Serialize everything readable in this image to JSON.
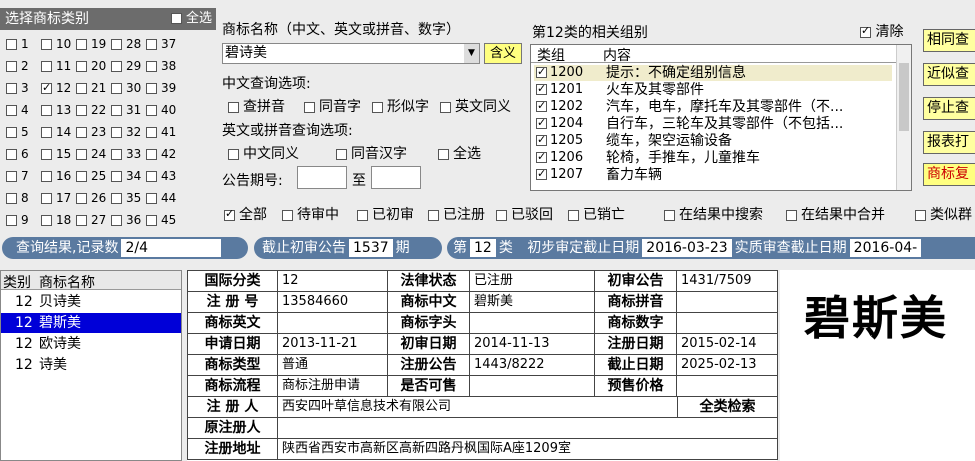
{
  "class_panel": {
    "title": "选择商标类别",
    "select_all": "全选",
    "classes": [
      [
        "1",
        "10",
        "19",
        "28",
        "37"
      ],
      [
        "2",
        "11",
        "20",
        "29",
        "38"
      ],
      [
        "3",
        "12",
        "21",
        "30",
        "39"
      ],
      [
        "4",
        "13",
        "22",
        "31",
        "40"
      ],
      [
        "5",
        "14",
        "23",
        "32",
        "41"
      ],
      [
        "6",
        "15",
        "24",
        "33",
        "42"
      ],
      [
        "7",
        "16",
        "25",
        "34",
        "43"
      ],
      [
        "8",
        "17",
        "26",
        "35",
        "44"
      ],
      [
        "9",
        "18",
        "27",
        "36",
        "45"
      ]
    ],
    "checked": "12"
  },
  "name_search": {
    "title": "商标名称（中文、英文或拼音、数字）",
    "value": "碧诗美",
    "hanyi_button": "含义",
    "cn_options_label": "中文查询选项:",
    "cn_options": [
      "查拼音",
      "同音字",
      "形似字",
      "英文同义"
    ],
    "en_options_label": "英文或拼音查询选项:",
    "en_options": [
      "中文同义",
      "同音汉字",
      "全选"
    ],
    "issue_label": "公告期号:",
    "issue_to": "至"
  },
  "groups": {
    "title": "第12类的相关组别",
    "clear_label": "清除",
    "col_group": "类组",
    "col_content": "内容",
    "rows": [
      {
        "code": "1200",
        "desc": "提示：不确定组别信息"
      },
      {
        "code": "1201",
        "desc": "火车及其零部件"
      },
      {
        "code": "1202",
        "desc": "汽车，电车，摩托车及其零部件（不..."
      },
      {
        "code": "1204",
        "desc": "自行车，三轮车及其零部件（不包括..."
      },
      {
        "code": "1205",
        "desc": "缆车，架空运输设备"
      },
      {
        "code": "1206",
        "desc": "轮椅，手推车，儿童推车"
      },
      {
        "code": "1207",
        "desc": "畜力车辆"
      }
    ]
  },
  "side_buttons": [
    "相同查",
    "近似查",
    "停止查",
    "报表打",
    "商标复"
  ],
  "filters": [
    "全部",
    "待审中",
    "已初审",
    "已注册",
    "已驳回",
    "已销亡",
    "在结果中搜索",
    "在结果中合并",
    "类似群"
  ],
  "status": {
    "result_label": "查询结果,记录数",
    "result_count": "2/4",
    "deadline_label": "截止初审公告",
    "deadline_value": "1537",
    "deadline_unit": "期",
    "class_prefix": "第",
    "class_value": "12",
    "class_suffix": "类",
    "prelim_label": "初步审定截止日期",
    "prelim_value": "2016-03-23",
    "actual_label": "实质审查截止日期",
    "actual_value": "2016-04-"
  },
  "results": {
    "col_class": "类别",
    "col_name": "商标名称",
    "rows": [
      {
        "cls": "12",
        "name": "贝诗美"
      },
      {
        "cls": "12",
        "name": "碧斯美"
      },
      {
        "cls": "12",
        "name": "欧诗美"
      },
      {
        "cls": "12",
        "name": "诗美"
      }
    ],
    "selected_index": 1
  },
  "detail": {
    "intl_class_k": "国际分类",
    "intl_class": "12",
    "legal_k": "法律状态",
    "legal": "已注册",
    "prelim_k": "初审公告",
    "prelim": "1431/7509",
    "regno_k": "注 册 号",
    "regno": "13584660",
    "cn_k": "商标中文",
    "cn": "碧斯美",
    "py_k": "商标拼音",
    "py": "",
    "en_k": "商标英文",
    "en": "",
    "head_k": "商标字头",
    "head": "",
    "num_k": "商标数字",
    "num": "",
    "apply_k": "申请日期",
    "apply": "2013-11-21",
    "prelim_date_k": "初审日期",
    "prelim_date": "2014-11-13",
    "reg_date_k": "注册日期",
    "reg_date": "2015-02-14",
    "type_k": "商标类型",
    "type": "普通",
    "reg_notice_k": "注册公告",
    "reg_notice": "1443/8222",
    "expire_k": "截止日期",
    "expire": "2025-02-13",
    "flow_k": "商标流程",
    "flow": "商标注册申请",
    "shared_k": "是否可售",
    "shared": "",
    "presale_k": "预售价格",
    "presale": "",
    "owner_k": "注 册 人",
    "owner": "西安四叶草信息技术有限公司",
    "allsearch": "全类检索",
    "orig_owner_k": "原注册人",
    "orig_owner": "",
    "addr_k": "注册地址",
    "addr": "陕西省西安市高新区高新四路丹枫国际A座1209室"
  },
  "big_name": "碧斯美"
}
